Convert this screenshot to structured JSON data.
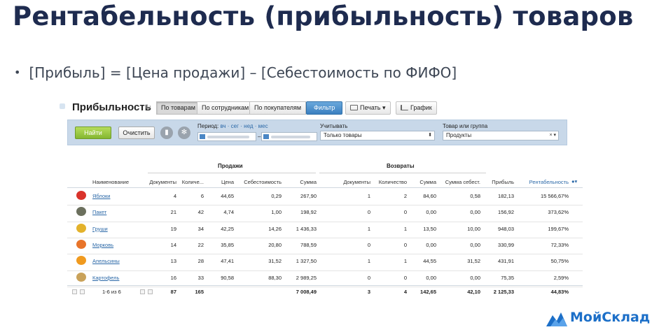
{
  "slide": {
    "title": "Рентабельность (прибыльность) товаров",
    "bullet": "[Прибыль] = [Цена продажи] – [Себестоимость по ФИФО]"
  },
  "app": {
    "page_title": "Прибыльность",
    "tabs": [
      {
        "label": "По товарам",
        "active": true
      },
      {
        "label": "По сотрудникам",
        "active": false
      },
      {
        "label": "По покупателям",
        "active": false
      }
    ],
    "filter_button": "Фильтр",
    "print_button": "Печать",
    "chart_button": "График"
  },
  "filters": {
    "find_button": "Найти",
    "clear_button": "Очистить",
    "period_label": "Период:",
    "period_links": "вч · сег · нед · мес",
    "consider_label": "Учитывать",
    "consider_value": "Только товары",
    "product_label": "Товар или группа",
    "product_value": "Продукты"
  },
  "table": {
    "group_sales": "Продажи",
    "group_returns": "Возвраты",
    "columns": {
      "name": "Наименование",
      "docs": "Документы",
      "qty": "Количе...",
      "price": "Цена",
      "cost": "Себестоимость",
      "sum": "Сумма",
      "ret_docs": "Документы",
      "ret_qty": "Количество",
      "ret_sum": "Сумма",
      "ret_cost_sum": "Сумма себест.",
      "profit": "Прибыль",
      "margin": "Рентабельность"
    },
    "rows": [
      {
        "name": "Яблоки",
        "icon": "apple-icon",
        "color": "#d9332b",
        "docs": "4",
        "qty": "6",
        "price": "44,65",
        "cost": "0,29",
        "sum": "267,90",
        "ret_docs": "1",
        "ret_qty": "2",
        "ret_sum": "84,60",
        "ret_cost_sum": "0,58",
        "profit": "182,13",
        "margin": "15 566,67%"
      },
      {
        "name": "Пакет",
        "icon": "bag-icon",
        "color": "#6b6f5d",
        "docs": "21",
        "qty": "42",
        "price": "4,74",
        "cost": "1,00",
        "sum": "198,92",
        "ret_docs": "0",
        "ret_qty": "0",
        "ret_sum": "0,00",
        "ret_cost_sum": "0,00",
        "profit": "156,92",
        "margin": "373,62%"
      },
      {
        "name": "Груши",
        "icon": "pear-icon",
        "color": "#e3b22b",
        "docs": "19",
        "qty": "34",
        "price": "42,25",
        "cost": "14,26",
        "sum": "1 436,33",
        "ret_docs": "1",
        "ret_qty": "1",
        "ret_sum": "13,50",
        "ret_cost_sum": "10,00",
        "profit": "948,03",
        "margin": "199,67%"
      },
      {
        "name": "Морковь",
        "icon": "carrot-icon",
        "color": "#e8742a",
        "docs": "14",
        "qty": "22",
        "price": "35,85",
        "cost": "20,80",
        "sum": "788,59",
        "ret_docs": "0",
        "ret_qty": "0",
        "ret_sum": "0,00",
        "ret_cost_sum": "0,00",
        "profit": "330,99",
        "margin": "72,33%"
      },
      {
        "name": "Апельсины",
        "icon": "orange-icon",
        "color": "#f09a1f",
        "docs": "13",
        "qty": "28",
        "price": "47,41",
        "cost": "31,52",
        "sum": "1 327,50",
        "ret_docs": "1",
        "ret_qty": "1",
        "ret_sum": "44,55",
        "ret_cost_sum": "31,52",
        "profit": "431,91",
        "margin": "50,75%"
      },
      {
        "name": "Картофель",
        "icon": "potato-icon",
        "color": "#c9a25a",
        "docs": "16",
        "qty": "33",
        "price": "90,58",
        "cost": "88,30",
        "sum": "2 989,25",
        "ret_docs": "0",
        "ret_qty": "0",
        "ret_sum": "0,00",
        "ret_cost_sum": "0,00",
        "profit": "75,35",
        "margin": "2,59%"
      }
    ],
    "footer": {
      "pager": "1-6 из 6",
      "docs": "87",
      "qty": "165",
      "sum": "7 008,49",
      "ret_docs": "3",
      "ret_qty": "4",
      "ret_sum": "142,65",
      "ret_cost_sum": "42,10",
      "profit": "2 125,33",
      "margin": "44,83%"
    }
  },
  "brand": {
    "name": "МойСклад",
    "color": "#1c6fc8"
  }
}
